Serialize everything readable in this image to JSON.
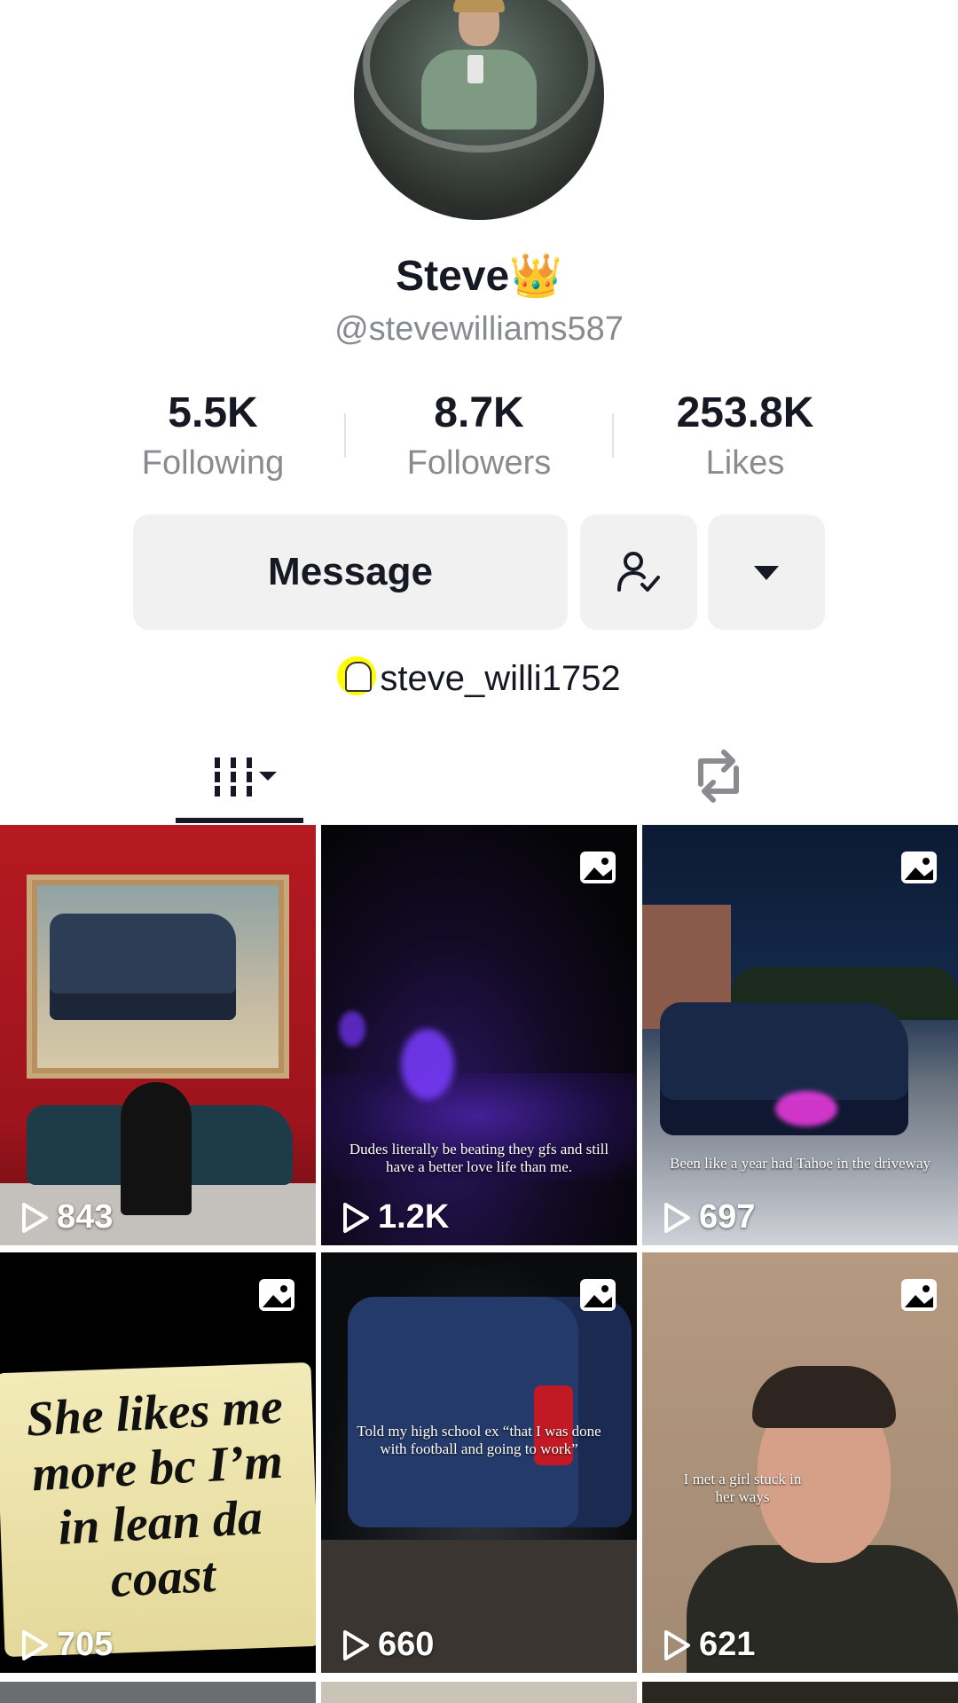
{
  "profile": {
    "name": "Steve",
    "name_emoji": "👑",
    "handle": "@stevewilliams587",
    "stats": [
      {
        "value": "5.5K",
        "label": "Following"
      },
      {
        "value": "8.7K",
        "label": "Followers"
      },
      {
        "value": "253.8K",
        "label": "Likes"
      }
    ],
    "buttons": {
      "message": "Message"
    },
    "snapchat": "steve_willi1752"
  },
  "icons": {
    "friend_button": "user-check-icon",
    "more_button": "caret-down-icon",
    "videos_tab": "grid-icon",
    "reposts_tab": "repost-icon",
    "view_count": "play-icon",
    "photo_post": "photo-icon"
  },
  "posts": [
    {
      "views": "843",
      "caption": "",
      "is_photo": false
    },
    {
      "views": "1.2K",
      "caption": "Dudes literally be beating they gfs and still have a better love life than me.",
      "is_photo": true
    },
    {
      "views": "697",
      "caption": "Been like a year had Tahoe in the driveway",
      "is_photo": true
    },
    {
      "views": "705",
      "caption": "She likes me more bc I’m in lean da coast",
      "is_photo": true
    },
    {
      "views": "660",
      "caption": "Told my high school ex “that I was done with football and going to work”",
      "is_photo": true
    },
    {
      "views": "621",
      "caption": "I met a girl stuck in her ways",
      "is_photo": true
    }
  ],
  "colors": {
    "text": "#161823",
    "secondary_text": "#8a8b91",
    "button_bg": "#f1f1f2"
  }
}
